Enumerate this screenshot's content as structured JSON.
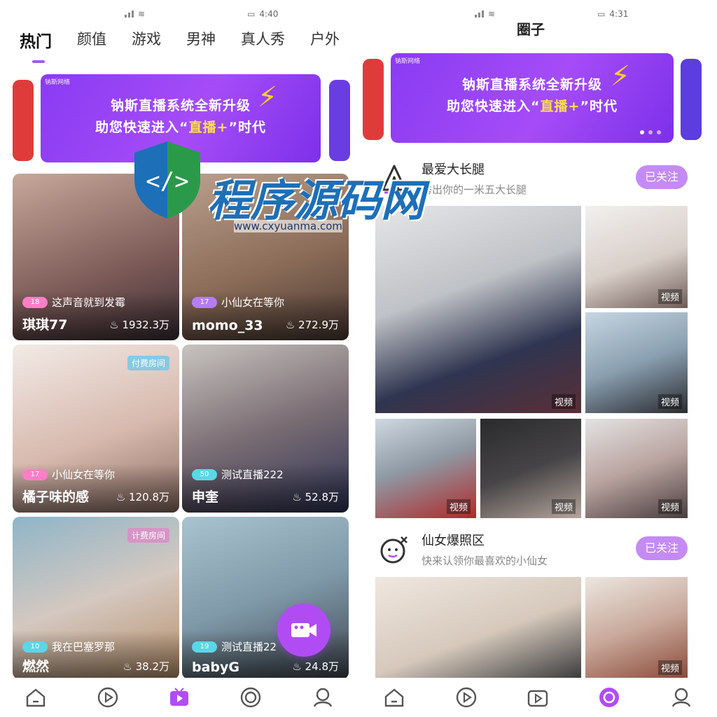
{
  "left": {
    "status": {
      "time": "4:40"
    },
    "tabs": [
      "热门",
      "颜值",
      "游戏",
      "男神",
      "真人秀",
      "户外"
    ],
    "banner": {
      "line1": "钠斯直播系统全新升级",
      "line2_a": "助您快速进入“",
      "line2_b": "直播+",
      "line2_c": "”时代"
    },
    "cards": [
      {
        "desc": "这声音就到发霉",
        "name": "琪琪77",
        "heat": "1932.3万",
        "level": "18",
        "tag": ""
      },
      {
        "desc": "小仙女在等你",
        "name": "momo_33",
        "heat": "272.9万",
        "level": "17",
        "tag": ""
      },
      {
        "desc": "小仙女在等你",
        "name": "橘子味的感",
        "heat": "120.8万",
        "level": "17",
        "tag": "付费房间"
      },
      {
        "desc": "测试直播222",
        "name": "申奎",
        "heat": "52.8万",
        "level": "50",
        "tag": ""
      },
      {
        "desc": "我在巴塞罗那",
        "name": "燃然",
        "heat": "38.2万",
        "level": "10",
        "tag": "计费房间"
      },
      {
        "desc": "测试直播22",
        "name": "babyG",
        "heat": "24.8万",
        "level": "19",
        "tag": ""
      }
    ],
    "nav": [
      "home-icon",
      "play-icon",
      "live-icon",
      "circle-icon",
      "profile-icon"
    ]
  },
  "right": {
    "status": {
      "time": "4:31"
    },
    "title": "圈子",
    "banner": {
      "line1": "钠斯直播系统全新升级",
      "line2_a": "助您快速进入“",
      "line2_b": "直播+",
      "line2_c": "”时代"
    },
    "sections": [
      {
        "title": "最爱大长腿",
        "subtitle": "秀出你的一米五大长腿",
        "follow": "已关注"
      },
      {
        "title": "仙女爆照区",
        "subtitle": "快来认领你最喜欢的小仙女",
        "follow": "已关注"
      }
    ],
    "video_label": "视频",
    "nav": [
      "home-icon",
      "play-icon",
      "live-icon",
      "circle-icon",
      "profile-icon"
    ]
  },
  "watermark": {
    "name": "程序源码网",
    "url": "www.cxyuanma.com"
  },
  "colors": {
    "accent": "#a15cf0",
    "banner": "#8a3bf3",
    "follow": "#c48af6"
  }
}
